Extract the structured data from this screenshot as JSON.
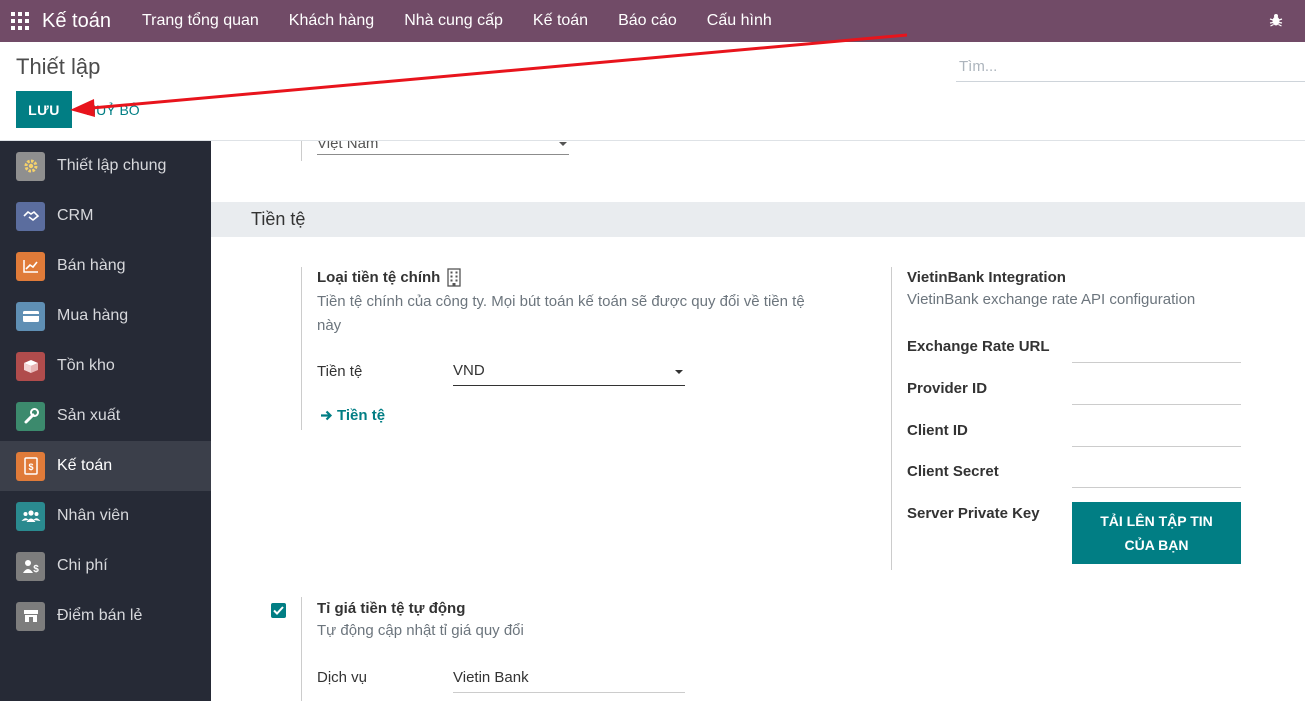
{
  "navbar": {
    "app_name": "Kế toán",
    "menu": [
      "Trang tổng quan",
      "Khách hàng",
      "Nhà cung cấp",
      "Kế toán",
      "Báo cáo",
      "Cấu hình"
    ]
  },
  "control_panel": {
    "title": "Thiết lập",
    "save_label": "LƯU",
    "discard_label": "HUỶ BỎ",
    "search_placeholder": "Tìm..."
  },
  "sidebar": {
    "items": [
      {
        "label": "Thiết lập chung",
        "icon": "gear-icon",
        "color": "#7d7d7d"
      },
      {
        "label": "CRM",
        "icon": "handshake-icon",
        "color": "#5b6d9e"
      },
      {
        "label": "Bán hàng",
        "icon": "chart-line-icon",
        "color": "#e07b39"
      },
      {
        "label": "Mua hàng",
        "icon": "credit-card-icon",
        "color": "#5f8fb4"
      },
      {
        "label": "Tồn kho",
        "icon": "box-icon",
        "color": "#b04c4c"
      },
      {
        "label": "Sản xuất",
        "icon": "wrench-icon",
        "color": "#3c8a6d"
      },
      {
        "label": "Kế toán",
        "icon": "invoice-icon",
        "color": "#e07b39"
      },
      {
        "label": "Nhân viên",
        "icon": "users-icon",
        "color": "#2a8a8f"
      },
      {
        "label": "Chi phí",
        "icon": "expense-icon",
        "color": "#7d7d7d"
      },
      {
        "label": "Điểm bán lẻ",
        "icon": "store-icon",
        "color": "#7d7d7d"
      }
    ],
    "active_index": 6
  },
  "main": {
    "country_value": "Việt Nam",
    "section_title": "Tiền tệ",
    "main_currency": {
      "title": "Loại tiền tệ chính",
      "description": "Tiền tệ chính của công ty. Mọi bút toán kế toán sẽ được quy đổi về tiền tệ này",
      "field_label": "Tiền tệ",
      "field_value": "VND",
      "link_label": "Tiền tệ"
    },
    "vietinbank": {
      "title": "VietinBank Integration",
      "description": "VietinBank exchange rate API configuration",
      "fields": [
        "Exchange Rate URL",
        "Provider ID",
        "Client ID",
        "Client Secret",
        "Server Private Key"
      ],
      "upload_label_line1": "TẢI LÊN TẬP TIN",
      "upload_label_line2": "CỦA BẠN"
    },
    "auto_rate": {
      "checked": true,
      "title": "Tỉ giá tiền tệ tự động",
      "description": "Tự động cập nhật tỉ giá quy đổi",
      "field_label": "Dịch vụ",
      "field_value": "Vietin Bank"
    }
  },
  "colors": {
    "navbar": "#714b67",
    "primary": "#017e84",
    "sidebar": "#262a36",
    "annotation_arrow": "#e8141c"
  }
}
